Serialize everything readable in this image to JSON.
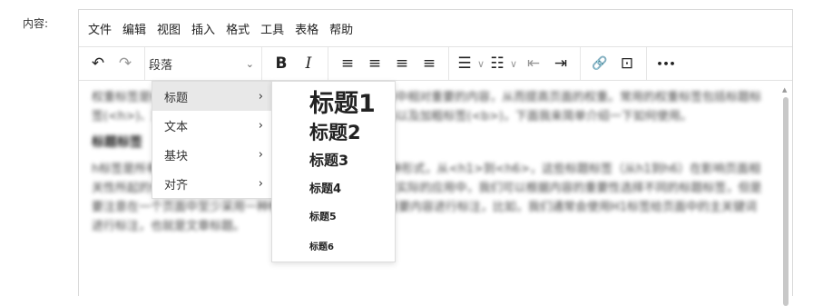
{
  "field": {
    "label": "内容:"
  },
  "menubar": {
    "items": [
      "文件",
      "编辑",
      "视图",
      "插入",
      "格式",
      "工具",
      "表格",
      "帮助"
    ]
  },
  "toolbar": {
    "format_select": "段落",
    "chev": "⌄",
    "undo": "↶",
    "redo": "↷",
    "bold": "B",
    "italic": "I",
    "align_left": "≡",
    "align_center": "≡",
    "align_right": "≡",
    "align_justify": "≡",
    "bullets": "☰",
    "numbered": "☷",
    "outdent": "⇤",
    "indent": "⇥",
    "link": "🔗",
    "image": "⊡",
    "more": "•••",
    "dd": "∨"
  },
  "format_menu": {
    "items": [
      {
        "label": "标题",
        "arrow": "›"
      },
      {
        "label": "文本",
        "arrow": "›"
      },
      {
        "label": "基块",
        "arrow": "›"
      },
      {
        "label": "对齐",
        "arrow": "›"
      }
    ]
  },
  "heading_menu": {
    "items": [
      "标题1",
      "标题2",
      "标题3",
      "标题4",
      "标题5",
      "标题6"
    ]
  },
  "content": {
    "p1": "权重标签是HTML中的一类标签，权重标签常用于突出页面中相对重要的内容，从而提高页面的权重。常用的权重标签包括标题标签(<h>)、加重语气标签(<strong>)、下划线标签(<u>)以及加粗标签(<b>)，下面我来简单介绍一下如何使用。",
    "h": "标题标签",
    "p2": "h标签是所有权重标签中最重要的，用于标题的作用，有6种形式，从<h1>到<h6>，这些标题标签（从h1到h6）在影响页面相关性所起的作用依次递减，h1>h2>h3>h4>h5>h6。在实际的应用中，我们可以根据内容的重要性选择不同的标题标签，但是要注意在一个页面中至少采用一种标题标签页面中的相对重要内容进行标注，比如，我们通常会使用H1标签给页面中的主关键词进行标注，也就是文章标题。"
  }
}
